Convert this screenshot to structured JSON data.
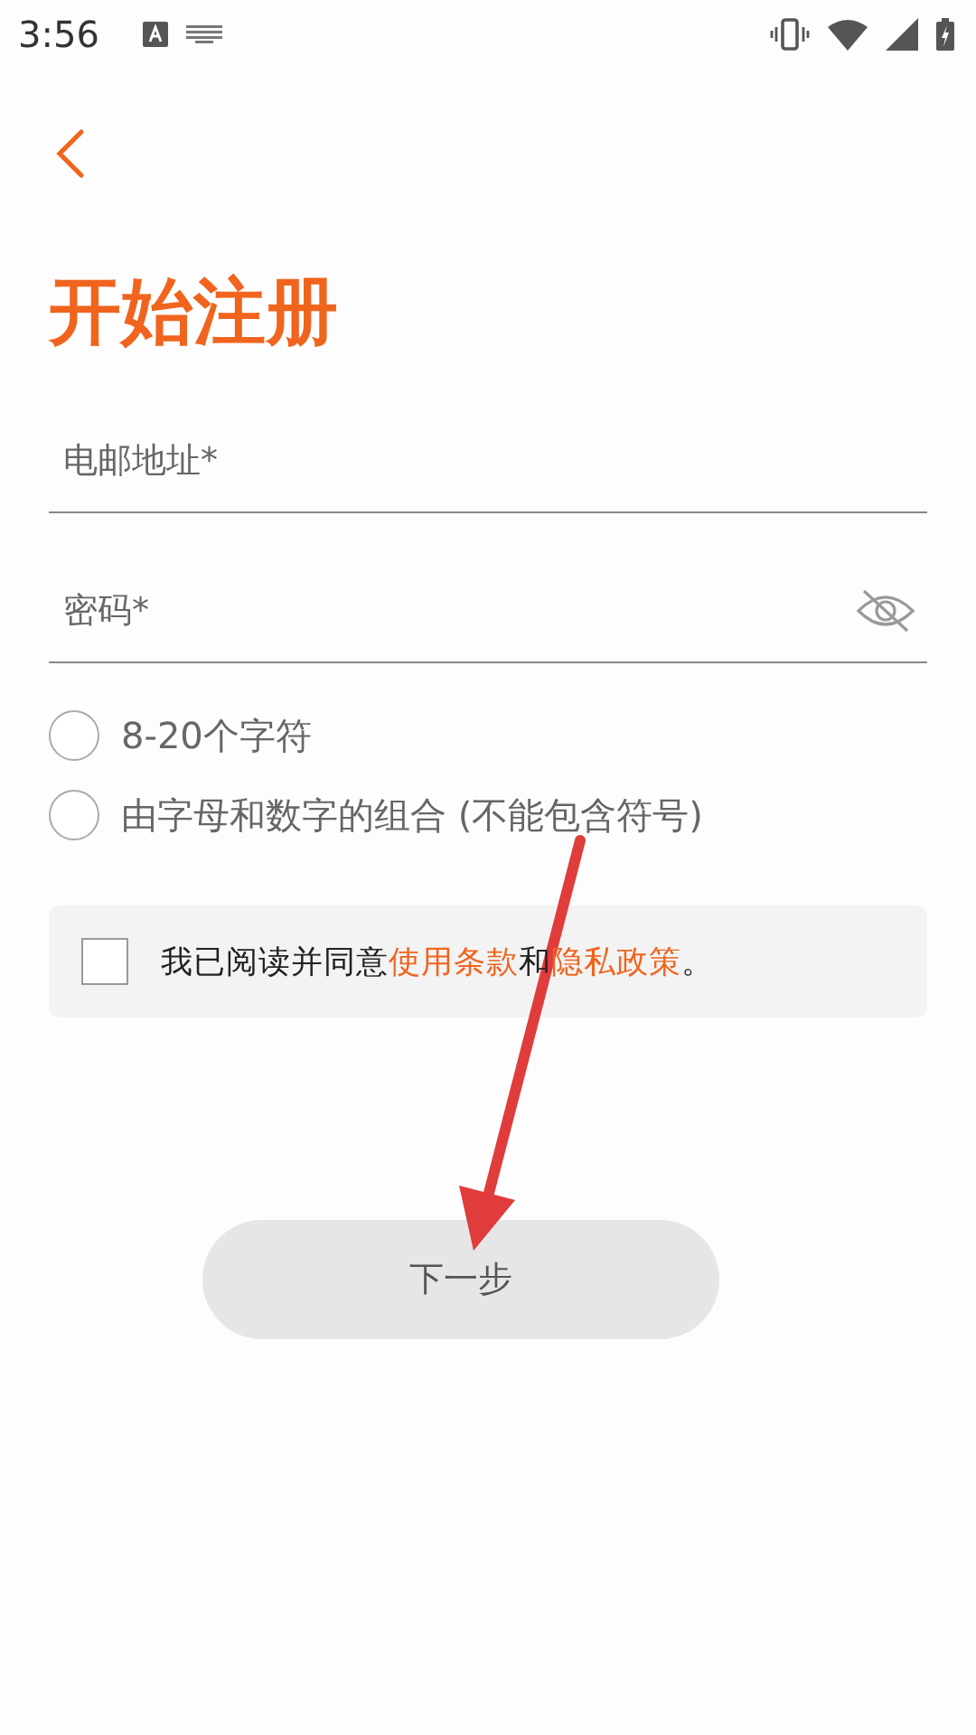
{
  "status_bar": {
    "time": "3:56"
  },
  "title": "开始注册",
  "fields": [
    {
      "placeholder": "电邮地址*",
      "kind": "text"
    },
    {
      "placeholder": "密码*",
      "kind": "password",
      "visible": false
    }
  ],
  "rules": [
    {
      "label": "8-20个字符",
      "checked": false
    },
    {
      "label": "由字母和数字的组合 (不能包含符号)",
      "checked": false
    }
  ],
  "agreement": {
    "checked": false,
    "prefix": "我已阅读并同意",
    "terms_link": "使用条款",
    "middle": "和",
    "privacy_link": "隐私政策",
    "suffix": "。"
  },
  "next_button": {
    "label": "下一步",
    "disabled": true
  }
}
